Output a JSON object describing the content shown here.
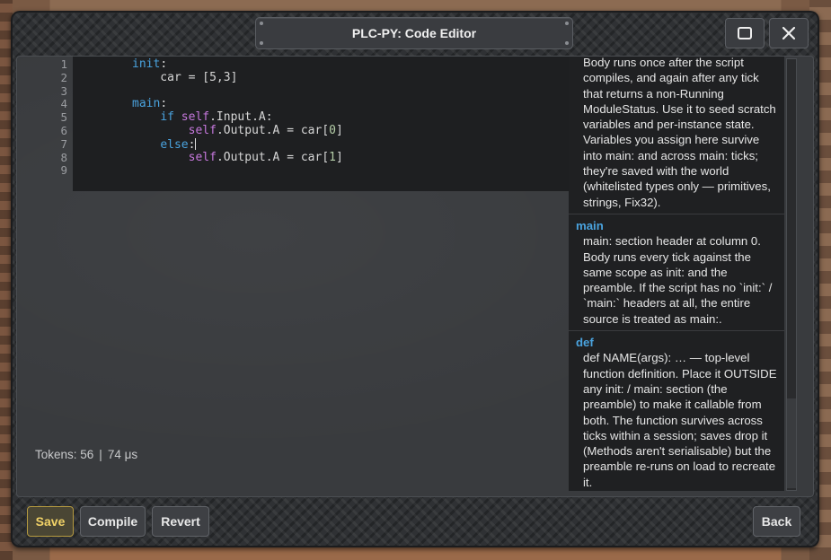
{
  "window": {
    "title": "PLC-PY: Code Editor"
  },
  "editor": {
    "line_numbers": [
      "1",
      "2",
      "3",
      "4",
      "5",
      "6",
      "7",
      "8",
      "9"
    ],
    "code_lines": [
      [
        {
          "t": "init",
          "c": "kw"
        },
        {
          "t": ":",
          "c": ""
        }
      ],
      [
        {
          "t": "    car = [5,3]",
          "c": ""
        }
      ],
      [],
      [
        {
          "t": "main",
          "c": "kw"
        },
        {
          "t": ":",
          "c": ""
        }
      ],
      [
        {
          "t": "    ",
          "c": ""
        },
        {
          "t": "if",
          "c": "kw"
        },
        {
          "t": " ",
          "c": ""
        },
        {
          "t": "self",
          "c": "kw2"
        },
        {
          "t": ".Input.A:",
          "c": ""
        }
      ],
      [
        {
          "t": "        ",
          "c": ""
        },
        {
          "t": "self",
          "c": "kw2"
        },
        {
          "t": ".Output.A = car[",
          "c": ""
        },
        {
          "t": "0",
          "c": "num"
        },
        {
          "t": "]",
          "c": ""
        }
      ],
      [
        {
          "t": "    ",
          "c": ""
        },
        {
          "t": "else",
          "c": "kw"
        },
        {
          "t": ":",
          "c": ""
        },
        {
          "t": "",
          "c": "cursor"
        }
      ],
      [
        {
          "t": "        ",
          "c": ""
        },
        {
          "t": "self",
          "c": "kw2"
        },
        {
          "t": ".Output.A = car[",
          "c": ""
        },
        {
          "t": "1",
          "c": "num"
        },
        {
          "t": "]",
          "c": ""
        }
      ],
      []
    ]
  },
  "status": {
    "tokens": "Tokens: 56",
    "separator": "|",
    "time": "74 μs"
  },
  "help": {
    "entries": [
      {
        "name": "",
        "body": "Body runs once after the script compiles, and again after any tick that returns a non-Running ModuleStatus. Use it to seed scratch variables and per-instance state. Variables you assign here survive into main: and across main: ticks; they're saved with the world (whitelisted types only — primitives, strings, Fix32)."
      },
      {
        "name": "main",
        "body": "main: section header at column 0. Body runs every tick against the same scope as init: and the preamble. If the script has no `init:` / `main:` headers at all, the entire source is treated as main:."
      },
      {
        "name": "def",
        "body": "def NAME(args): … — top-level function definition. Place it OUTSIDE any init: / main: section (the preamble) to make it callable from both. The function survives across ticks within a session; saves drop it (Methods aren't serialisable) but the preamble re-runs on load to recreate it."
      }
    ]
  },
  "buttons": {
    "save": "Save",
    "compile": "Compile",
    "revert": "Revert",
    "back": "Back"
  },
  "icons": {
    "maximize": "maximize-icon",
    "close": "close-icon"
  }
}
